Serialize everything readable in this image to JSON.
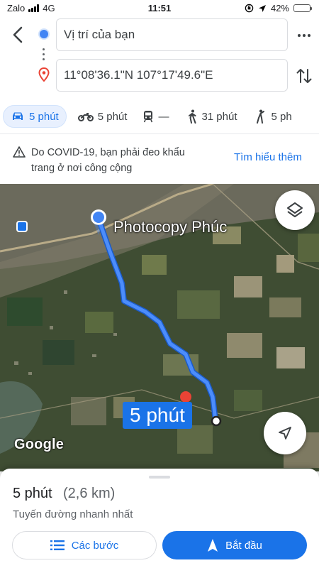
{
  "status_bar": {
    "carrier": "Zalo",
    "network": "4G",
    "time": "11:51",
    "battery": "42%",
    "battery_level": 0.42
  },
  "header": {
    "origin_value": "Vị trí của bạn",
    "destination_value": "11°08'36.1\"N 107°17'49.6\"E"
  },
  "travel_modes": [
    {
      "mode": "drive",
      "icon": "car-icon",
      "label": "5 phút",
      "selected": true
    },
    {
      "mode": "motorbike",
      "icon": "motorbike-icon",
      "label": "5 phút",
      "selected": false
    },
    {
      "mode": "transit",
      "icon": "train-icon",
      "label": "—",
      "selected": false
    },
    {
      "mode": "walk",
      "icon": "walk-icon",
      "label": "31 phút",
      "selected": false
    },
    {
      "mode": "ride",
      "icon": "ride-hail-icon",
      "label": "5 ph",
      "selected": false
    }
  ],
  "notice": {
    "icon": "warning-icon",
    "text_line1": "Do COVID-19, bạn phải đeo khẩu",
    "text_line2": "trang ở nơi công cộng",
    "link": "Tìm hiểu thêm"
  },
  "map": {
    "place_label": "Photocopy Phúc",
    "eta_label": "5 phút",
    "logo_text": "Google",
    "route_color": "#4c8dfb"
  },
  "sheet": {
    "duration": "5 phút",
    "distance": "(2,6 km)",
    "subtitle": "Tuyến đường nhanh nhất",
    "steps_label": "Các bước",
    "start_label": "Bắt đầu"
  },
  "colors": {
    "accent": "#1a73e8",
    "origin": "#4285f4",
    "destination": "#ea4335"
  }
}
